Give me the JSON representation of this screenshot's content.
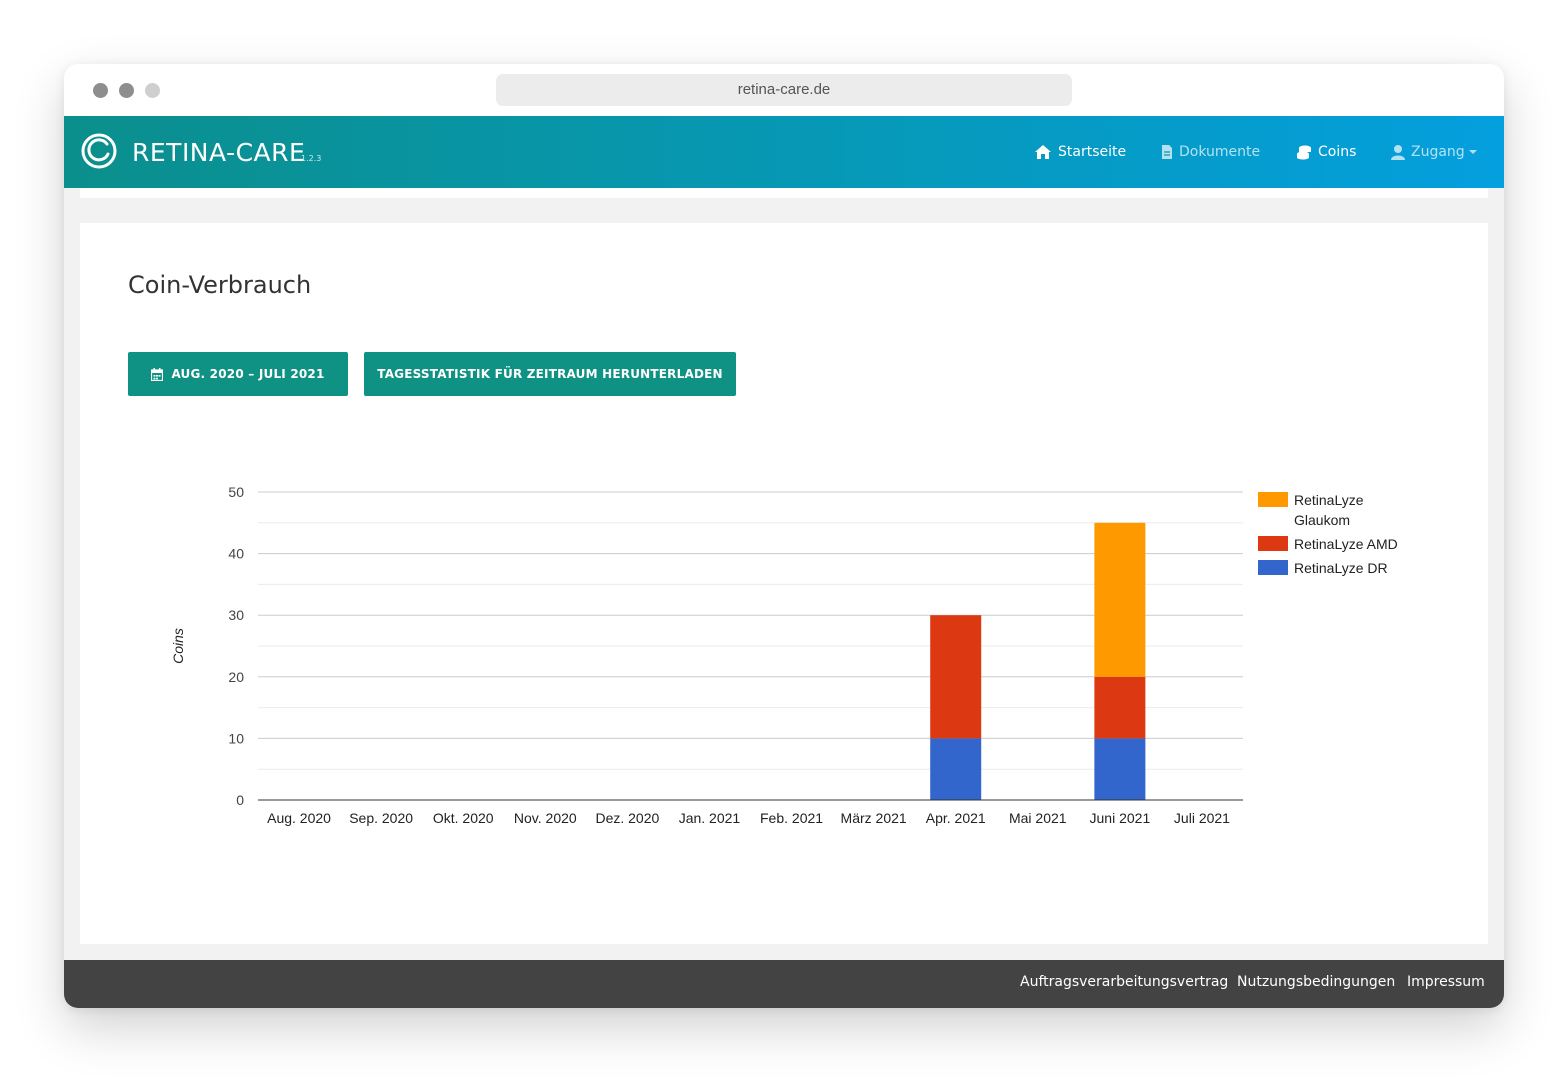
{
  "browser": {
    "url": "retina-care.de"
  },
  "navbar": {
    "brand": "RETINA-CARE",
    "version": "1.2.3",
    "items": [
      {
        "label": "Startseite",
        "icon": "home-icon"
      },
      {
        "label": "Dokumente",
        "icon": "document-icon"
      },
      {
        "label": "Coins",
        "icon": "coins-icon"
      },
      {
        "label": "Zugang",
        "icon": "user-icon"
      }
    ]
  },
  "page": {
    "title": "Coin-Verbrauch",
    "date_range_button": "AUG. 2020 – JULI 2021",
    "download_button": "TAGESSTATISTIK FÜR ZEITRAUM HERUNTERLADEN"
  },
  "chart_data": {
    "type": "bar",
    "stacked": true,
    "categories": [
      "Aug. 2020",
      "Sep. 2020",
      "Okt. 2020",
      "Nov. 2020",
      "Dez. 2020",
      "Jan. 2021",
      "Feb. 2021",
      "März 2021",
      "Apr. 2021",
      "Mai 2021",
      "Juni 2021",
      "Juli 2021"
    ],
    "series": [
      {
        "name": "RetinaLyze DR",
        "color": "#3366cc",
        "values": [
          0,
          0,
          0,
          0,
          0,
          0,
          0,
          0,
          10,
          0,
          10,
          0
        ]
      },
      {
        "name": "RetinaLyze AMD",
        "color": "#dc3912",
        "values": [
          0,
          0,
          0,
          0,
          0,
          0,
          0,
          0,
          20,
          0,
          10,
          0
        ]
      },
      {
        "name": "RetinaLyze Glaukom",
        "color": "#ff9900",
        "values": [
          0,
          0,
          0,
          0,
          0,
          0,
          0,
          0,
          0,
          0,
          25,
          0
        ]
      }
    ],
    "legend_order": [
      "RetinaLyze Glaukom",
      "RetinaLyze AMD",
      "RetinaLyze DR"
    ],
    "legend_position": "right",
    "xlabel": "",
    "ylabel": "Coins",
    "ylim": [
      0,
      50
    ],
    "yticks": [
      0,
      10,
      20,
      30,
      40,
      50
    ],
    "grid": true
  },
  "footer": {
    "links": [
      "Auftragsverarbeitungsvertrag",
      "Nutzungsbedingungen",
      "Impressum"
    ]
  }
}
